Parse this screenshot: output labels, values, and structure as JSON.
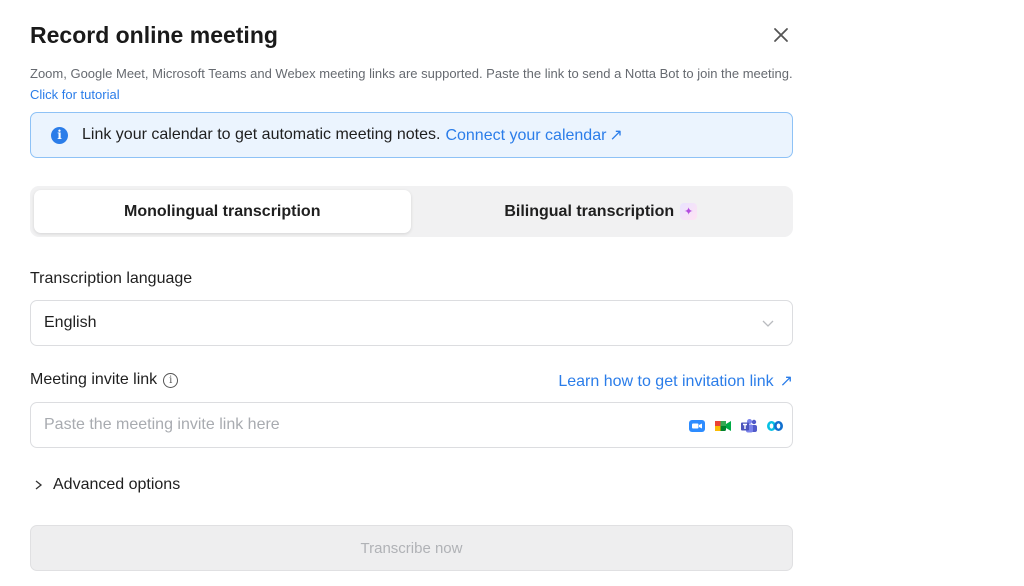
{
  "dialog": {
    "title": "Record online meeting",
    "description_text": "Zoom, Google Meet, Microsoft Teams and Webex meeting links are supported. Paste the link to send a Notta Bot to join the meeting.",
    "tutorial_link": "Click for tutorial"
  },
  "banner": {
    "text": "Link your calendar to get automatic meeting notes.",
    "connect_link": "Connect your calendar",
    "connect_arrow": "↗"
  },
  "mode_tabs": {
    "monolingual": "Monolingual transcription",
    "bilingual": "Bilingual transcription",
    "selected": "monolingual"
  },
  "language": {
    "label": "Transcription language",
    "value": "English"
  },
  "invite": {
    "label": "Meeting invite link",
    "learn_link": "Learn how to get invitation link",
    "learn_arrow": "↗",
    "placeholder": "Paste the meeting invite link here",
    "value": "",
    "supported_apps": [
      "zoom-icon",
      "google-meet-icon",
      "microsoft-teams-icon",
      "webex-icon"
    ]
  },
  "advanced": {
    "label": "Advanced options"
  },
  "submit": {
    "label": "Transcribe now",
    "enabled": false
  },
  "colors": {
    "accent": "#2b7de9",
    "banner_bg": "#ebf4fe",
    "banner_border": "#8ec2f6",
    "disabled_bg": "#eeeeef",
    "disabled_text": "#b0b2b6"
  }
}
